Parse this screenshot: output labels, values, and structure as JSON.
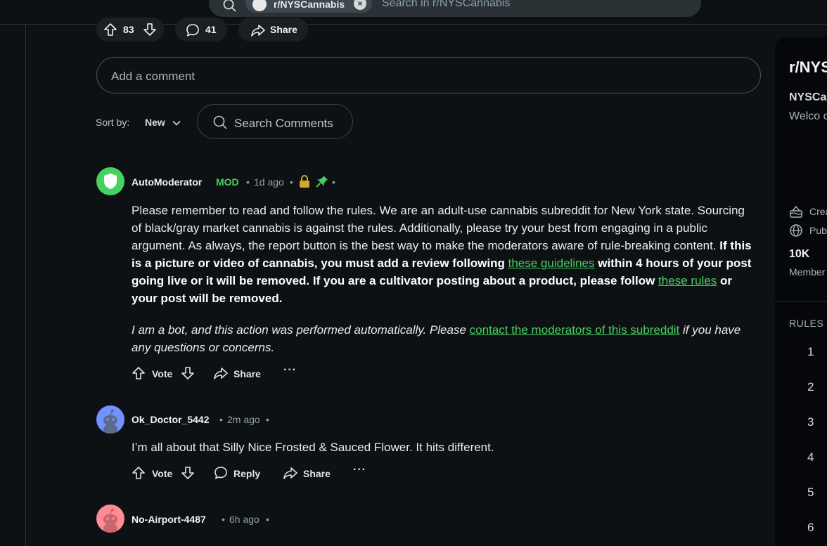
{
  "header": {
    "community_chip": "r/NYSCannabis",
    "search_placeholder": "Search in r/NYSCannabis"
  },
  "post_actions": {
    "vote_count": "83",
    "comment_count": "41",
    "share_label": "Share"
  },
  "add_comment_placeholder": "Add a comment",
  "sort": {
    "label": "Sort by:",
    "value": "New"
  },
  "search_comments_placeholder": "Search Comments",
  "comments": [
    {
      "username": "AutoModerator",
      "mod_badge": "MOD",
      "time": "1d ago",
      "body_plain": "Please remember to read and follow the rules. We are an adult-use cannabis subreddit for New York state. Sourcing of black/gray market cannabis is against the rules. Additionally, please try your best from engaging in a public argument. As always, the report button is the best way to make the moderators aware of rule-breaking content.",
      "body_bold_1": "If this is a picture or video of cannabis, you must add a review following",
      "link_1": "these guidelines",
      "body_bold_2": "within 4 hours of your post going live or it will be removed. If you are a cultivator posting about a product, please follow",
      "link_2": "these rules",
      "body_bold_3": "or your post will be removed.",
      "bot_note_1": "I am a bot, and this action was performed automatically. Please",
      "bot_link": "contact the moderators of this subreddit",
      "bot_note_2": "if you have any questions or concerns.",
      "vote_label": "Vote",
      "share_label": "Share"
    },
    {
      "username": "Ok_Doctor_5442",
      "time": "2m ago",
      "body": "I’m all about that Silly Nice Frosted & Sauced Flower. It hits different.",
      "vote_label": "Vote",
      "reply_label": "Reply",
      "share_label": "Share"
    },
    {
      "username": "No-Airport-4487",
      "time": "6h ago"
    }
  ],
  "sidebar": {
    "title": "r/NYS",
    "name": "NYSCa",
    "description": "Welco commu York sta",
    "created_label": "Crea",
    "public_label": "Pub",
    "members_count": "10K",
    "members_label": "Member",
    "rules_heading": "RULES",
    "rule_numbers": [
      "1",
      "2",
      "3",
      "4",
      "5",
      "6"
    ]
  },
  "colors": {
    "background": "#0e1113",
    "accent_green": "#46d160",
    "mod_lock": "#d4a52a"
  }
}
